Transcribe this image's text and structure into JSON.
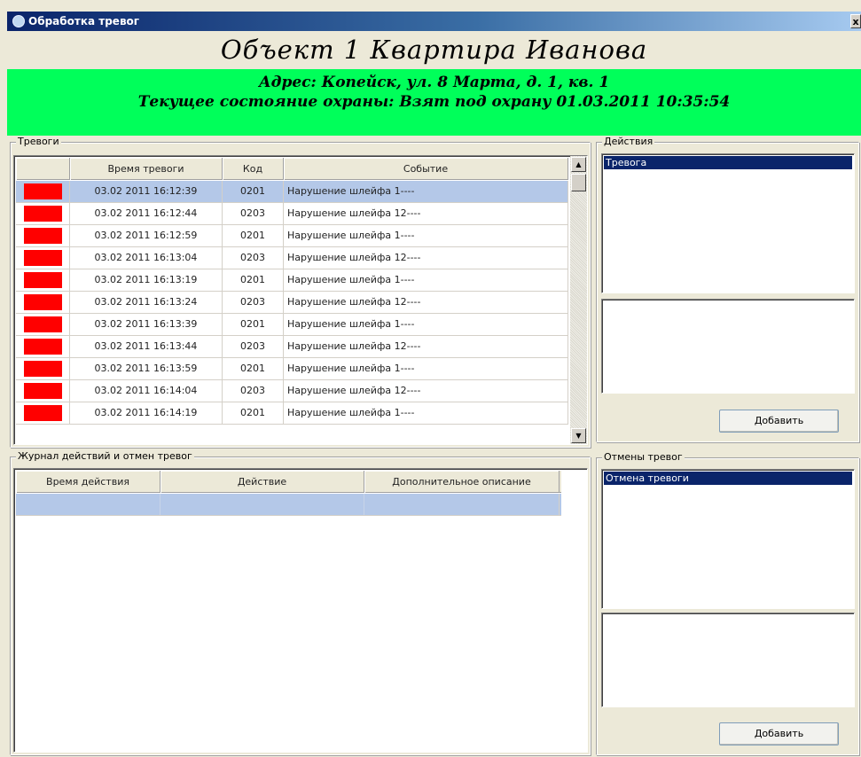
{
  "window": {
    "title": "Обработка тревог",
    "close_glyph": "x"
  },
  "object": {
    "title": "Объект  1  Квартира Иванова",
    "address": "Адрес: Копейск, ул. 8 Марта, д. 1, кв. 1",
    "status": "Текущее состояние охраны: Взят под охрану 01.03.2011 10:35:54",
    "status_color": "#00ff5a"
  },
  "alarms": {
    "group_label": "Тревоги",
    "columns": [
      "",
      "Время тревоги",
      "Код",
      "Событие"
    ],
    "swatch_color": "#ff0000",
    "rows": [
      {
        "time": "03.02 2011 16:12:39",
        "code": "0201",
        "event": "Нарушение шлейфа 1----"
      },
      {
        "time": "03.02 2011 16:12:44",
        "code": "0203",
        "event": "Нарушение шлейфа 12----"
      },
      {
        "time": "03.02 2011 16:12:59",
        "code": "0201",
        "event": "Нарушение шлейфа 1----"
      },
      {
        "time": "03.02 2011 16:13:04",
        "code": "0203",
        "event": "Нарушение шлейфа 12----"
      },
      {
        "time": "03.02 2011 16:13:19",
        "code": "0201",
        "event": "Нарушение шлейфа 1----"
      },
      {
        "time": "03.02 2011 16:13:24",
        "code": "0203",
        "event": "Нарушение шлейфа 12----"
      },
      {
        "time": "03.02 2011 16:13:39",
        "code": "0201",
        "event": "Нарушение шлейфа 1----"
      },
      {
        "time": "03.02 2011 16:13:44",
        "code": "0203",
        "event": "Нарушение шлейфа 12----"
      },
      {
        "time": "03.02 2011 16:13:59",
        "code": "0201",
        "event": "Нарушение шлейфа 1----"
      },
      {
        "time": "03.02 2011 16:14:04",
        "code": "0203",
        "event": "Нарушение шлейфа 12----"
      },
      {
        "time": "03.02 2011 16:14:19",
        "code": "0201",
        "event": "Нарушение шлейфа 1----"
      }
    ]
  },
  "journal": {
    "group_label": "Журнал действий и отмен тревог",
    "columns": [
      "Время действия",
      "Действие",
      "Дополнительное описание"
    ]
  },
  "actions": {
    "group_label": "Действия",
    "items": [
      "Тревога"
    ],
    "add_label": "Добавить"
  },
  "cancels": {
    "group_label": "Отмены тревог",
    "items": [
      "Отмена тревоги"
    ],
    "add_label": "Добавить"
  }
}
